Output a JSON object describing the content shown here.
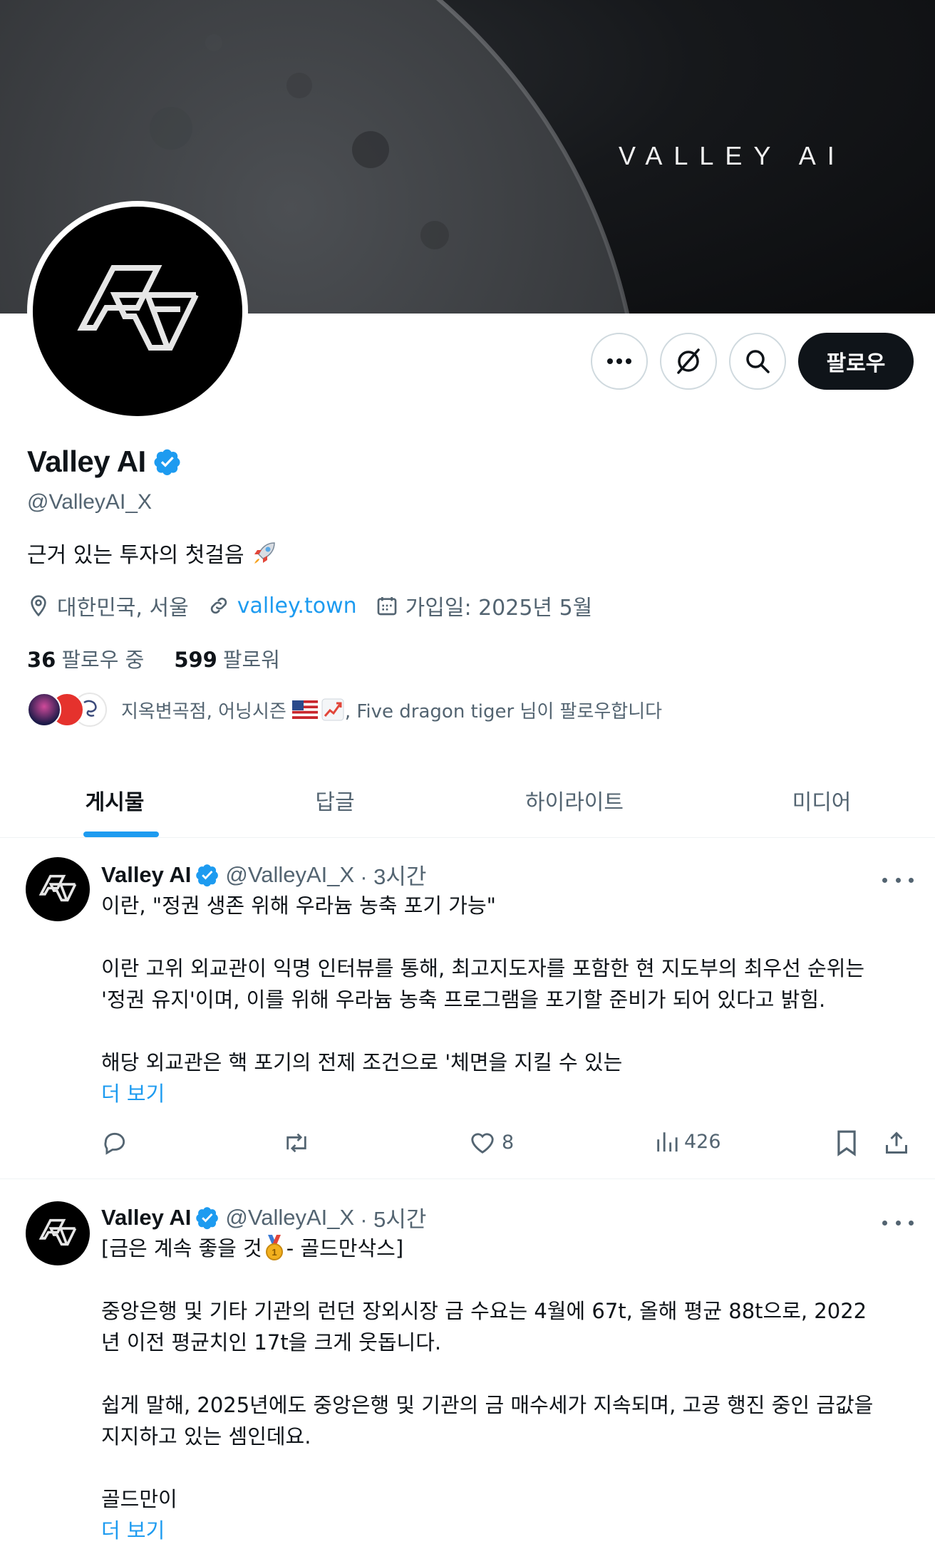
{
  "banner": {
    "text": "VALLEY AI"
  },
  "profile": {
    "name": "Valley AI",
    "handle": "@ValleyAI_X",
    "bio": "근거 있는 투자의 첫걸음",
    "location": "대한민국, 서울",
    "link": "valley.town",
    "joined": "가입일: 2025년 5월",
    "following_count": "36",
    "following_label": "팔로우 중",
    "followers_count": "599",
    "followers_label": "팔로워",
    "followed_by_text_1": "지옥변곡점, 어닝시즌",
    "followed_by_text_2": ", Five dragon tiger 님이 팔로우합니다"
  },
  "actions": {
    "follow_label": "팔로우",
    "more_icon": "more-icon",
    "grok_icon": "grok-icon",
    "search_icon": "search-icon"
  },
  "tabs": [
    {
      "label": "게시물",
      "active": true
    },
    {
      "label": "답글",
      "active": false
    },
    {
      "label": "하이라이트",
      "active": false
    },
    {
      "label": "미디어",
      "active": false
    }
  ],
  "posts": [
    {
      "name": "Valley AI",
      "handle": "@ValleyAI_X",
      "time": "· 3시간",
      "lines": [
        "이란, \"정권 생존 위해 우라늄 농축 포기 가능\"",
        "",
        "이란 고위 외교관이 익명 인터뷰를 통해, 최고지도자를 포함한 현 지도부의 최우선 순위는",
        "'정권 유지'이며, 이를 위해 우라늄 농축 프로그램을 포기할 준비가 되어 있다고 밝힘.",
        "",
        "해당 외교관은 핵 포기의 전제 조건으로 '체면을 지킬 수 있는"
      ],
      "more": "더 보기",
      "likes": "8",
      "views": "426"
    },
    {
      "name": "Valley AI",
      "handle": "@ValleyAI_X",
      "time": "· 5시간",
      "line1_a": "[금은 계속 좋을 것",
      "line1_b": " - 골드만삭스]",
      "lines": [
        "",
        "중앙은행 및 기타 기관의 런던 장외시장 금 수요는 4월에 67t, 올해 평균 88t으로, 2022",
        "년 이전 평균치인 17t을 크게 웃돕니다.",
        "",
        "쉽게 말해, 2025년에도 중앙은행 및 기관의 금 매수세가 지속되며, 고공 행진 중인 금값을",
        "지지하고 있는 셈인데요.",
        "",
        "골드만이"
      ],
      "more": "더 보기"
    }
  ],
  "colors": {
    "accent": "#1d9bf0",
    "text": "#0f1419",
    "muted": "#536471",
    "border": "#eff3f4"
  }
}
